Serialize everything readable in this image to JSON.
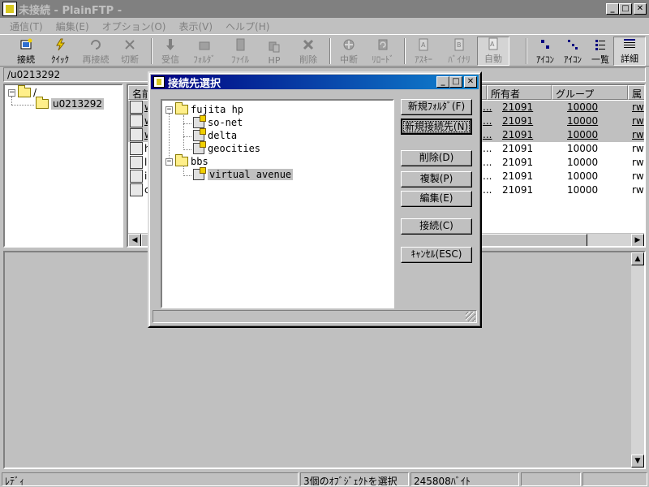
{
  "window": {
    "title": "未接続 - PlainFTP -"
  },
  "menu": [
    "通信(T)",
    "編集(E)",
    "オプション(O)",
    "表示(V)",
    "ヘルプ(H)"
  ],
  "toolbar": [
    {
      "label": "接続",
      "icon": "connect-icon"
    },
    {
      "label": "ｸｲｯｸ",
      "icon": "quick-connect-icon"
    },
    {
      "label": "再接続",
      "icon": "reconnect-icon"
    },
    {
      "label": "切断",
      "icon": "disconnect-icon"
    },
    {
      "label": "受信",
      "icon": "download-icon"
    },
    {
      "label": "ﾌｫﾙﾀﾞ",
      "icon": "folder-icon"
    },
    {
      "label": "ﾌｧｲﾙ",
      "icon": "file-icon"
    },
    {
      "label": "HP",
      "icon": "homepage-icon"
    },
    {
      "label": "削除",
      "icon": "delete-icon"
    },
    {
      "label": "中断",
      "icon": "abort-icon"
    },
    {
      "label": "ﾘﾛｰﾄﾞ",
      "icon": "reload-icon"
    },
    {
      "label": "ｱｽｷｰ",
      "icon": "ascii-icon"
    },
    {
      "label": "ﾊﾞｲﾅﾘ",
      "icon": "binary-icon"
    },
    {
      "label": "自動",
      "icon": "auto-icon"
    },
    {
      "label": "ｱｲｺﾝ",
      "icon": "large-icons-view-icon"
    },
    {
      "label": "ｱｲｺﾝ",
      "icon": "small-icons-view-icon"
    },
    {
      "label": "一覧",
      "icon": "list-view-icon"
    },
    {
      "label": "詳細",
      "icon": "details-view-icon"
    }
  ],
  "path": "/u0213292",
  "tree": {
    "root": "/",
    "child": "u0213292"
  },
  "list": {
    "headers": [
      "名前",
      "所有者",
      "グループ",
      "属"
    ],
    "rows": [
      {
        "name": "w",
        "owner": "21091",
        "group": "10000",
        "perm": "rw",
        "size": "...",
        "hl": true
      },
      {
        "name": "w",
        "owner": "21091",
        "group": "10000",
        "perm": "rw",
        "size": "...",
        "hl": true
      },
      {
        "name": "w",
        "owner": "21091",
        "group": "10000",
        "perm": "rw",
        "size": "...",
        "hl": true
      },
      {
        "name": "h",
        "owner": "21091",
        "group": "10000",
        "perm": "rw",
        "size": "...",
        "hl": false
      },
      {
        "name": "li",
        "owner": "21091",
        "group": "10000",
        "perm": "rw",
        "size": "...",
        "hl": false
      },
      {
        "name": "ir",
        "owner": "21091",
        "group": "10000",
        "perm": "rw",
        "size": "...",
        "hl": false
      },
      {
        "name": "c",
        "owner": "21091",
        "group": "10000",
        "perm": "rw",
        "size": "...",
        "hl": false
      }
    ]
  },
  "status": {
    "ready": "ﾚﾃﾞｨ",
    "selection": "3個のｵﾌﾞｼﾞｪｸﾄを選択",
    "bytes": "245808ﾊﾞｲﾄ"
  },
  "dialog": {
    "title": "接続先選択",
    "tree": {
      "group1": "fujita hp",
      "g1items": [
        "so-net",
        "delta",
        "geocities"
      ],
      "group2": "bbs",
      "g2items": [
        "virtual avenue"
      ]
    },
    "buttons": {
      "new_folder": "新規ﾌｫﾙﾀﾞ(F)",
      "new_site": "新規接続先(N)",
      "delete": "削除(D)",
      "copy": "複製(P)",
      "edit": "編集(E)",
      "connect": "接続(C)",
      "cancel": "ｷｬﾝｾﾙ(ESC)"
    }
  }
}
